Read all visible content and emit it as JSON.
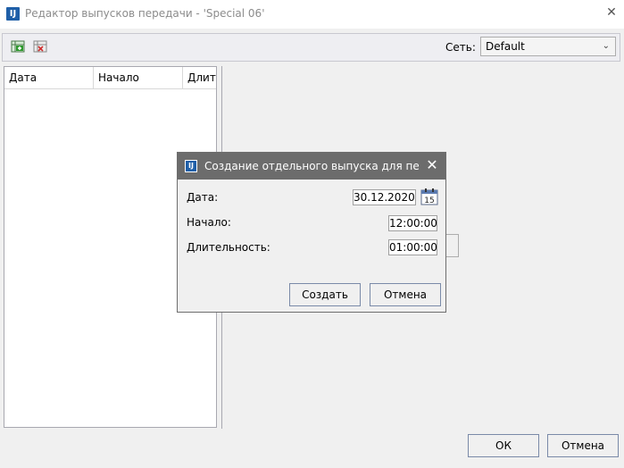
{
  "window": {
    "title": "Редактор выпусков передачи - 'Special 06'",
    "close_glyph": "✕",
    "app_icon": "IJ"
  },
  "toolbar": {
    "add_icon": "add-item-icon",
    "delete_icon": "delete-item-icon",
    "network_label": "Сеть:",
    "network_value": "Default",
    "chevron": "⌄"
  },
  "grid": {
    "columns": [
      "Дата",
      "Начало",
      "Длит."
    ]
  },
  "footer": {
    "ok_label": "ОК",
    "cancel_label": "Отмена"
  },
  "dialog": {
    "title": "Создание отдельного выпуска для перед...",
    "close_glyph": "✕",
    "icon": "IJ",
    "date_label": "Дата:",
    "date_value": "30.12.2020",
    "calendar_day": "15",
    "start_label": "Начало:",
    "start_value": "12:00:00",
    "duration_label": "Длительность:",
    "duration_value": "01:00:00",
    "create_label": "Создать",
    "cancel_label": "Отмена"
  },
  "colors": {
    "dialog_title_bg": "#6c6c6c",
    "accent": "#1f5fa8",
    "button_border": "#7a8aa8"
  }
}
